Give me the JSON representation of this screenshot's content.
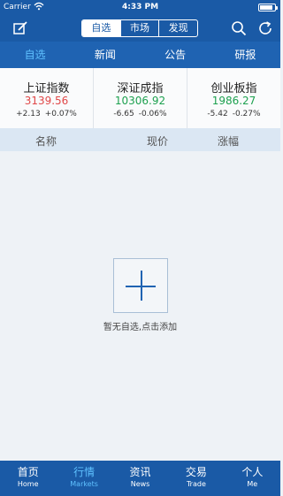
{
  "status": {
    "carrier": "Carrier",
    "time": "4:33 PM",
    "battery_level": 0.9
  },
  "top": {
    "segments": [
      {
        "label": "自选",
        "active": true
      },
      {
        "label": "市场",
        "active": false
      },
      {
        "label": "发现",
        "active": false
      }
    ],
    "icons": [
      "edit-icon",
      "search-icon",
      "refresh-icon"
    ]
  },
  "sub_tabs": [
    {
      "label": "自选",
      "active": true
    },
    {
      "label": "新闻",
      "active": false
    },
    {
      "label": "公告",
      "active": false
    },
    {
      "label": "研报",
      "active": false
    }
  ],
  "indices": [
    {
      "name": "上证指数",
      "value": "3139.56",
      "change": "+2.13",
      "pct": "+0.07%",
      "trend": "up"
    },
    {
      "name": "深证成指",
      "value": "10306.92",
      "change": "-6.65",
      "pct": "-0.06%",
      "trend": "down"
    },
    {
      "name": "创业板指",
      "value": "1986.27",
      "change": "-5.42",
      "pct": "-0.27%",
      "trend": "down"
    }
  ],
  "list_header": {
    "name": "名称",
    "price": "现价",
    "change": "涨幅"
  },
  "empty": {
    "message": "暂无自选,点击添加"
  },
  "tab_bar": [
    {
      "zh": "首页",
      "en": "Home",
      "active": false
    },
    {
      "zh": "行情",
      "en": "Markets",
      "active": true
    },
    {
      "zh": "资讯",
      "en": "News",
      "active": false
    },
    {
      "zh": "交易",
      "en": "Trade",
      "active": false
    },
    {
      "zh": "个人",
      "en": "Me",
      "active": false
    }
  ],
  "colors": {
    "brand": "#1a5aa6",
    "active_tab": "#5fc1ff",
    "up": "#e04848",
    "down": "#1ea150"
  }
}
